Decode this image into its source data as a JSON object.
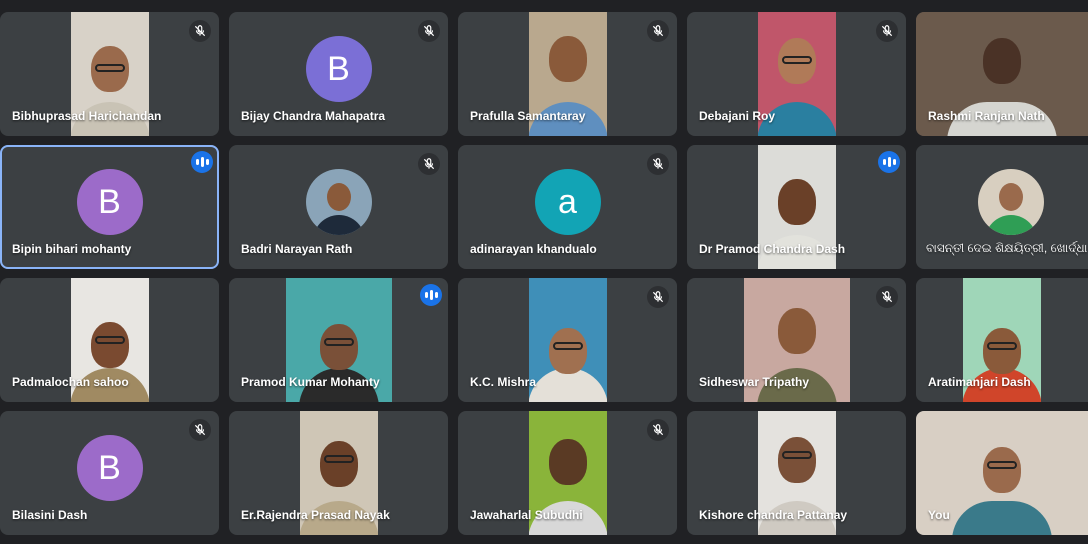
{
  "participants": [
    {
      "name": "Bibhuprasad Harichandan",
      "muted": true
    },
    {
      "name": "Bijay Chandra Mahapatra",
      "muted": true,
      "initial": "B",
      "avatar_color": "#7b6fd6"
    },
    {
      "name": "Prafulla Samantaray",
      "muted": true
    },
    {
      "name": "Debajani Roy",
      "muted": true
    },
    {
      "name": "Rashmi Ranjan Nath",
      "muted": false
    },
    {
      "name": "Bipin bihari mohanty",
      "muted": false,
      "speaking": true,
      "initial": "B",
      "avatar_color": "#9c6bc9"
    },
    {
      "name": "Badri Narayan Rath",
      "muted": true
    },
    {
      "name": "adinarayan khandualo",
      "muted": true,
      "initial": "a",
      "avatar_color": "#12a4b5"
    },
    {
      "name": "Dr Pramod Chandra Dash",
      "muted": false,
      "speaking": true
    },
    {
      "name": "ବାସନ୍ତୀ ଦେଇ ଶିକ୍ଷୟିତ୍ରୀ, ଖୋର୍ଦ୍ଧା -ଅନୁଗୁ",
      "muted": false
    },
    {
      "name": "Padmalochan sahoo",
      "muted": false
    },
    {
      "name": "Pramod Kumar Mohanty",
      "muted": false,
      "speaking": true
    },
    {
      "name": "K.C. Mishra",
      "muted": true
    },
    {
      "name": "Sidheswar Tripathy",
      "muted": true
    },
    {
      "name": "Aratimanjari Dash",
      "muted": false
    },
    {
      "name": "Bilasini Dash",
      "muted": true,
      "initial": "B",
      "avatar_color": "#9c6bc9"
    },
    {
      "name": "Er.Rajendra Prasad Nayak",
      "muted": false
    },
    {
      "name": "Jawaharlal Subudhi",
      "muted": true
    },
    {
      "name": "Kishore chandra Pattanay",
      "muted": false
    },
    {
      "name": "You",
      "muted": false
    }
  ],
  "colors": {
    "background": "#202124",
    "tile": "#3c4043",
    "speaking_accent": "#1a73e8",
    "active_outline": "#8ab4f8"
  }
}
